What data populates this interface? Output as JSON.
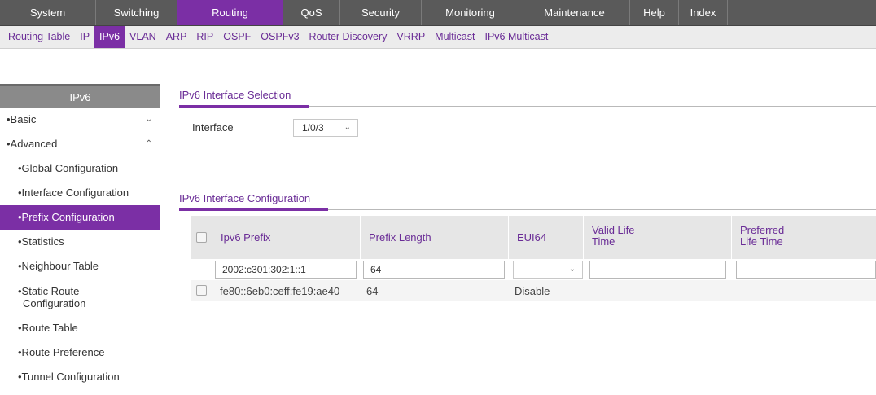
{
  "topnav": {
    "items": [
      {
        "label": "System"
      },
      {
        "label": "Switching"
      },
      {
        "label": "Routing"
      },
      {
        "label": "QoS"
      },
      {
        "label": "Security"
      },
      {
        "label": "Monitoring"
      },
      {
        "label": "Maintenance"
      },
      {
        "label": "Help"
      },
      {
        "label": "Index"
      }
    ],
    "active": "Routing"
  },
  "subnav": {
    "items": [
      {
        "label": "Routing Table"
      },
      {
        "label": "IP"
      },
      {
        "label": "IPv6"
      },
      {
        "label": "VLAN"
      },
      {
        "label": "ARP"
      },
      {
        "label": "RIP"
      },
      {
        "label": "OSPF"
      },
      {
        "label": "OSPFv3"
      },
      {
        "label": "Router Discovery"
      },
      {
        "label": "VRRP"
      },
      {
        "label": "Multicast"
      },
      {
        "label": "IPv6 Multicast"
      }
    ],
    "active": "IPv6"
  },
  "sidebar": {
    "header": "IPv6",
    "items": [
      {
        "label": "•Basic",
        "chevron": "⌄"
      },
      {
        "label": "•Advanced",
        "chevron": "⌃"
      },
      {
        "label": "•Global Configuration"
      },
      {
        "label": "•Interface Configuration"
      },
      {
        "label": "•Prefix Configuration"
      },
      {
        "label": "•Statistics"
      },
      {
        "label": "•Neighbour Table"
      },
      {
        "label": "•Static Route",
        "label2": "Configuration"
      },
      {
        "label": "•Route Table"
      },
      {
        "label": "•Route Preference"
      },
      {
        "label": "•Tunnel Configuration"
      }
    ]
  },
  "interface_selection": {
    "title": "IPv6 Interface Selection",
    "label": "Interface",
    "value": "1/0/3"
  },
  "interface_configuration": {
    "title": "IPv6 Interface Configuration",
    "columns": {
      "prefix": "Ipv6 Prefix",
      "length": "Prefix Length",
      "eui64": "EUI64",
      "valid_1": "Valid Life",
      "valid_2": "Time",
      "preferred_1": "Preferred",
      "preferred_2": "Life Time"
    },
    "edit_row": {
      "prefix": "2002:c301:302:1::1",
      "length": "64",
      "eui64": "",
      "valid": "",
      "preferred": ""
    },
    "rows": [
      {
        "prefix": "fe80::6eb0:ceff:fe19:ae40",
        "length": "64",
        "eui64": "Disable",
        "valid": "",
        "preferred": ""
      }
    ]
  },
  "colors": {
    "accent": "#7b2fa5",
    "link": "#6a2c96",
    "nav_bg": "#5a5a5a"
  }
}
